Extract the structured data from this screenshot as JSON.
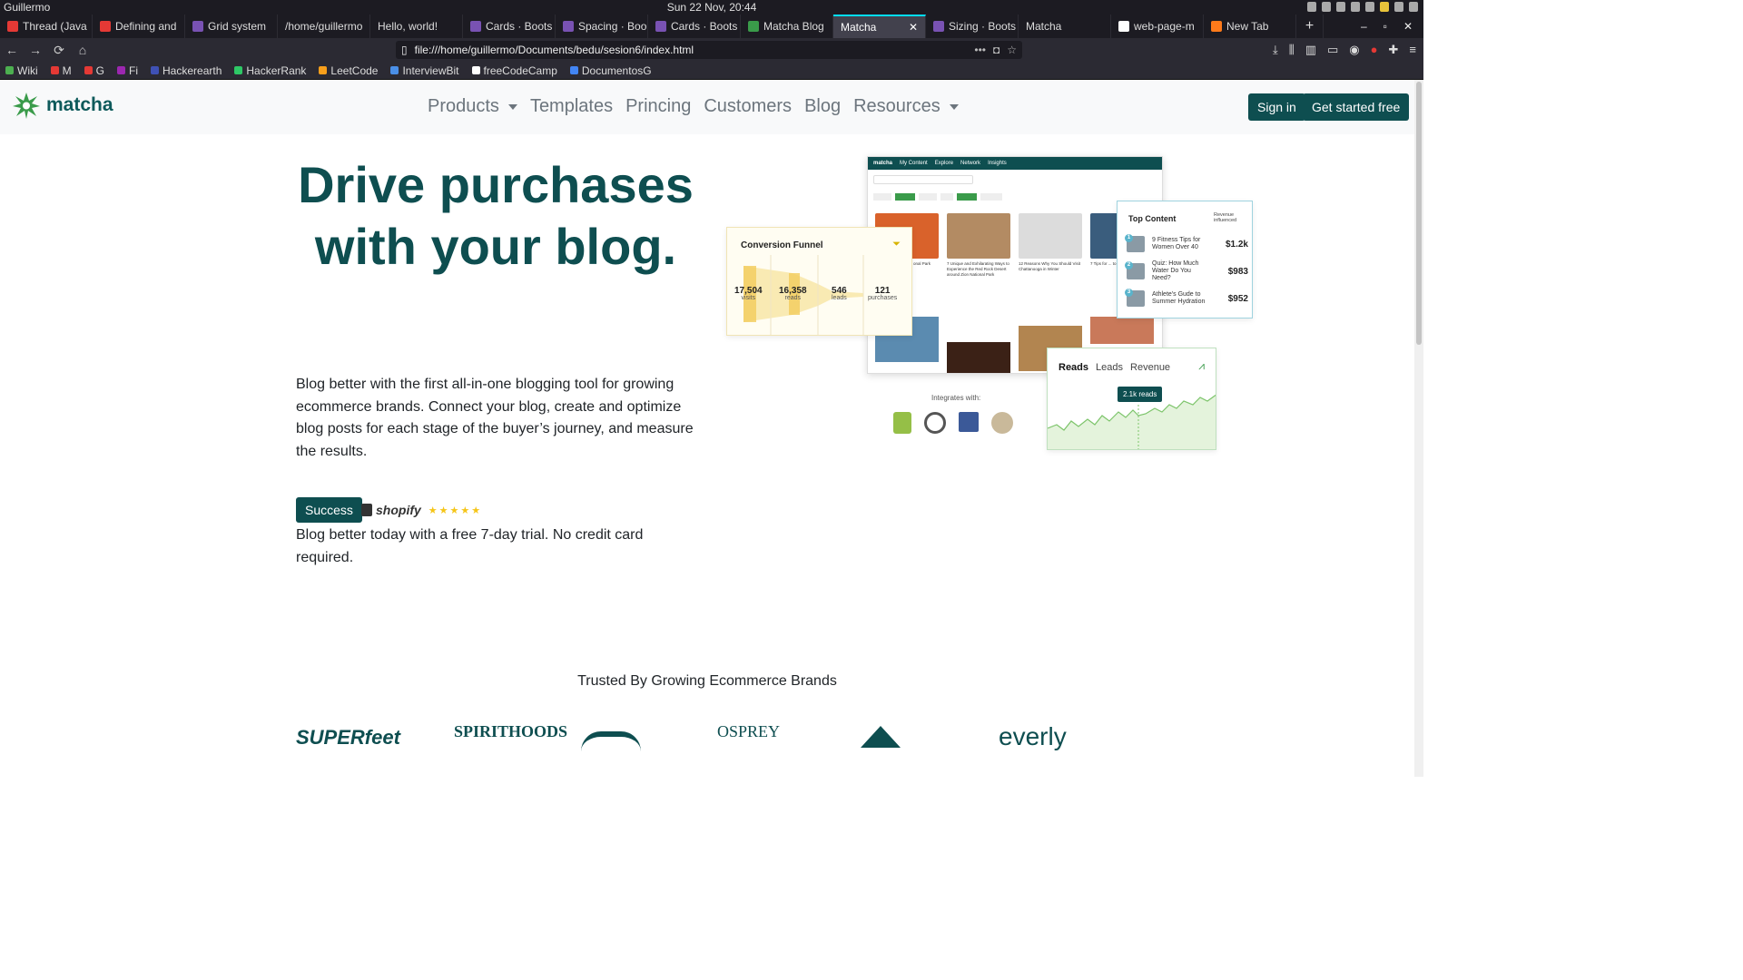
{
  "os": {
    "user": "Guillermo",
    "clock": "Sun 22 Nov, 20:44"
  },
  "tabs": [
    {
      "label": "Thread (Java",
      "color": "#e53935",
      "active": false
    },
    {
      "label": "Defining and",
      "color": "#e53935",
      "active": false
    },
    {
      "label": "Grid system",
      "color": "#7952b3",
      "active": false
    },
    {
      "label": "/home/guillermo",
      "color": "",
      "active": false
    },
    {
      "label": "Hello, world!",
      "color": "",
      "active": false
    },
    {
      "label": "Cards · Boots",
      "color": "#7952b3",
      "active": false
    },
    {
      "label": "Spacing · Boo",
      "color": "#7952b3",
      "active": false
    },
    {
      "label": "Cards · Boots",
      "color": "#7952b3",
      "active": false
    },
    {
      "label": "Matcha Blog",
      "color": "#3a9b4a",
      "active": false
    },
    {
      "label": "Matcha",
      "color": "",
      "active": true
    },
    {
      "label": "Sizing · Boots",
      "color": "#7952b3",
      "active": false
    },
    {
      "label": "Matcha",
      "color": "",
      "active": false
    },
    {
      "label": "web-page-m",
      "color": "#ffffff",
      "active": false
    },
    {
      "label": "New Tab",
      "color": "#ff7a1a",
      "active": false
    }
  ],
  "url": "file:///home/guillermo/Documents/bedu/sesion6/index.html",
  "bookmarks": [
    {
      "label": "Wiki",
      "color": "#4caf50"
    },
    {
      "label": "M",
      "color": "#e53935"
    },
    {
      "label": "G",
      "color": "#e53935"
    },
    {
      "label": "Fi",
      "color": "#9c27b0"
    },
    {
      "label": "Hackerearth",
      "color": "#3f51b5"
    },
    {
      "label": "HackerRank",
      "color": "#2ec866"
    },
    {
      "label": "LeetCode",
      "color": "#f89f1b"
    },
    {
      "label": "InterviewBit",
      "color": "#4a8fe7"
    },
    {
      "label": "freeCodeCamp",
      "color": "#ffffff"
    },
    {
      "label": "DocumentosG",
      "color": "#4285f4"
    }
  ],
  "site": {
    "brand": "matcha",
    "nav": {
      "products": "Products",
      "templates": "Templates",
      "pricing": "Princing",
      "customers": "Customers",
      "blog": "Blog",
      "resources": "Resources"
    },
    "signin": "Sign in",
    "get_started": "Get started free",
    "hero_title": "Drive purchases with your blog.",
    "hero_text": "Blog better with the first all-in-one blogging tool for growing ecommerce brands. Connect your blog, create and optimize blog posts for each stage of the buyer’s journey, and measure the results.",
    "badge": "Success",
    "shopify": "shopify",
    "stars": "★★★★★",
    "trial": "Blog better today with a free 7-day trial. No credit card required.",
    "trusted": "Trusted By Growing Ecommerce Brands",
    "brands": [
      "SUPERfeet",
      "SPIRITHOODS",
      "",
      "OSPREY",
      "",
      "everly"
    ]
  },
  "mockup": {
    "brand": "matcha",
    "nav": [
      "My Content",
      "Explore",
      "Network",
      "Insights"
    ],
    "funnel": {
      "title": "Conversion Funnel",
      "stats": [
        {
          "value": "17,504",
          "label": "visits"
        },
        {
          "value": "16,358",
          "label": "reads"
        },
        {
          "value": "546",
          "label": "leads"
        },
        {
          "value": "121",
          "label": "purchases"
        }
      ]
    },
    "top_content": {
      "title": "Top Content",
      "rev": "Revenue influenced",
      "rows": [
        {
          "n": "1",
          "title": "9 Fitness Tips for Women Over 40",
          "value": "$1.2k"
        },
        {
          "n": "2",
          "title": "Quiz: How Much Water Do You Need?",
          "value": "$983"
        },
        {
          "n": "3",
          "title": "Athlete's Gude to Summer Hydration",
          "value": "$952"
        }
      ]
    },
    "reads": {
      "tabs": [
        "Reads",
        "Leads",
        "Revenue"
      ],
      "tip": "2.1k reads"
    },
    "integrates": "Integrates with:",
    "cards": [
      {
        "cap": "... Before ... Great ... onal Park",
        "color": "#d9622b"
      },
      {
        "cap": "7 Unique and Exhilarating Ways to Experience the Red Rock Desert around Zion National Park",
        "color": "#b38b63"
      },
      {
        "cap": "12 Reasons Why You Should Visit Chattanooga in Winter",
        "color": "#dcdcdc"
      },
      {
        "cap": "7 Tips for ... to Outdoor ...",
        "color": "#3a5d7d"
      }
    ]
  }
}
